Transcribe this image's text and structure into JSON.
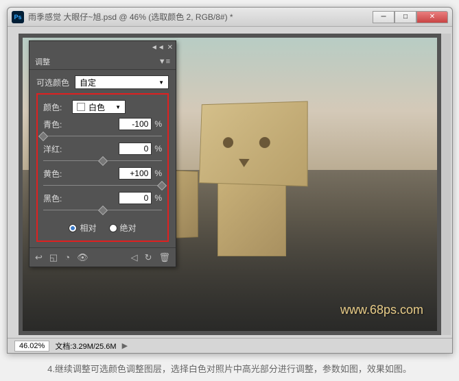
{
  "title": "雨季感觉  大眼仔~旭.psd @ 46% (选取颜色 2, RGB/8#) *",
  "panel": {
    "tab": "调整",
    "adjustment_label": "可选颜色",
    "preset": "自定",
    "color_label": "颜色:",
    "color_value": "白色",
    "sliders": [
      {
        "label": "青色:",
        "value": "-100",
        "pos": 0
      },
      {
        "label": "洋红:",
        "value": "0",
        "pos": 50
      },
      {
        "label": "黄色:",
        "value": "+100",
        "pos": 100
      },
      {
        "label": "黑色:",
        "value": "0",
        "pos": 50
      }
    ],
    "radio_relative": "相对",
    "radio_absolute": "绝对"
  },
  "status": {
    "zoom": "46.02%",
    "doc": "文档:3.29M/25.6M"
  },
  "watermark": "www.68ps.com",
  "caption": "4.继续调整可选颜色调整图层，选择白色对照片中高光部分进行调整，参数如图，效果如图。"
}
